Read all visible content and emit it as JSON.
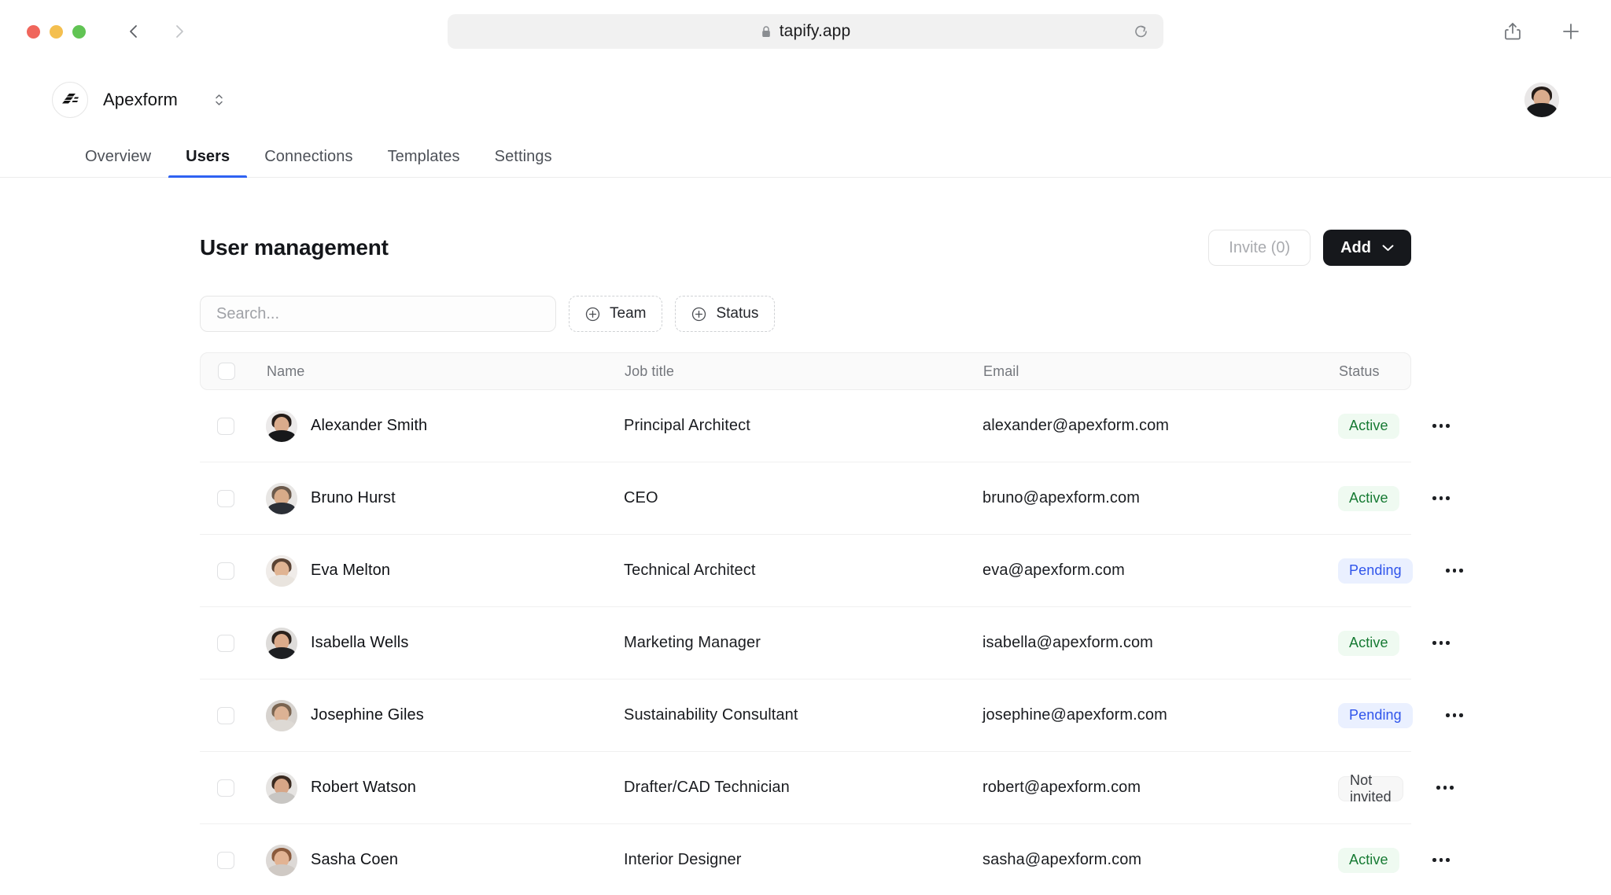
{
  "browser": {
    "url": "tapify.app",
    "lock_icon": "lock-icon",
    "reload_icon": "reload-icon",
    "back_icon": "chevron-left-icon",
    "forward_icon": "chevron-right-icon",
    "share_icon": "share-icon",
    "new_tab_icon": "plus-icon",
    "traffic_lights": [
      "close",
      "minimize",
      "maximize"
    ]
  },
  "header": {
    "workspace_name": "Apexform",
    "workspace_logo_icon": "apexform-logo-icon",
    "workspace_switch_icon": "chevron-up-down-icon",
    "user_avatar_icon": "user-avatar"
  },
  "tabs": [
    {
      "label": "Overview",
      "active": false
    },
    {
      "label": "Users",
      "active": true
    },
    {
      "label": "Connections",
      "active": false
    },
    {
      "label": "Templates",
      "active": false
    },
    {
      "label": "Settings",
      "active": false
    }
  ],
  "main": {
    "title": "User management",
    "invite_label": "Invite (0)",
    "add_label": "Add",
    "add_chevron_icon": "chevron-down-icon"
  },
  "filters": {
    "search_placeholder": "Search...",
    "search_value": "",
    "chips": [
      {
        "label": "Team",
        "icon": "plus-circle-icon"
      },
      {
        "label": "Status",
        "icon": "plus-circle-icon"
      }
    ]
  },
  "table": {
    "columns": [
      "Name",
      "Job title",
      "Email",
      "Status"
    ],
    "select_all_checked": false,
    "row_menu_icon": "ellipsis-icon",
    "rows": [
      {
        "name": "Alexander Smith",
        "job": "Principal Architect",
        "email": "alexander@apexform.com",
        "status": "Active",
        "status_type": "active",
        "checked": false,
        "avatar": {
          "skin": "#d9ab8c",
          "hair": "#241c18",
          "shirt": "#17181a",
          "bg": "#eceaea"
        }
      },
      {
        "name": "Bruno Hurst",
        "job": "CEO",
        "email": "bruno@apexform.com",
        "status": "Active",
        "status_type": "active",
        "checked": false,
        "avatar": {
          "skin": "#d8ab89",
          "hair": "#6b5a4c",
          "shirt": "#2b2f36",
          "bg": "#e8e6e4"
        }
      },
      {
        "name": "Eva Melton",
        "job": "Technical Architect",
        "email": "eva@apexform.com",
        "status": "Pending",
        "status_type": "pending",
        "checked": false,
        "avatar": {
          "skin": "#e0b493",
          "hair": "#5a4334",
          "shirt": "#e9e4de",
          "bg": "#f0ece9"
        }
      },
      {
        "name": "Isabella Wells",
        "job": "Marketing Manager",
        "email": "isabella@apexform.com",
        "status": "Active",
        "status_type": "active",
        "checked": false,
        "avatar": {
          "skin": "#dbab8b",
          "hair": "#2a211c",
          "shirt": "#1d1f22",
          "bg": "#dedcda"
        }
      },
      {
        "name": "Josephine Giles",
        "job": "Sustainability Consultant",
        "email": "josephine@apexform.com",
        "status": "Pending",
        "status_type": "pending",
        "checked": false,
        "avatar": {
          "skin": "#dcb294",
          "hair": "#7a6450",
          "shirt": "#ddd9d4",
          "bg": "#d7d3cf"
        }
      },
      {
        "name": "Robert Watson",
        "job": "Drafter/CAD Technician",
        "email": "robert@apexform.com",
        "status": "Not invited",
        "status_type": "notinvited",
        "checked": false,
        "avatar": {
          "skin": "#d7a687",
          "hair": "#3a2a20",
          "shirt": "#c8c6c3",
          "bg": "#e6e4e2"
        }
      },
      {
        "name": "Sasha Coen",
        "job": "Interior Designer",
        "email": "sasha@apexform.com",
        "status": "Active",
        "status_type": "active",
        "checked": false,
        "avatar": {
          "skin": "#e2b393",
          "hair": "#8a5a3c",
          "shirt": "#cfc9c4",
          "bg": "#ddd9d6"
        }
      }
    ]
  },
  "colors": {
    "accent": "#2f62f2",
    "active_text": "#167a33",
    "active_bg": "#effaf1",
    "pending_text": "#2f54eb",
    "pending_bg": "#eaf0ff",
    "notinvited_bg": "#f7f7f7",
    "button_dark": "#16181c"
  }
}
